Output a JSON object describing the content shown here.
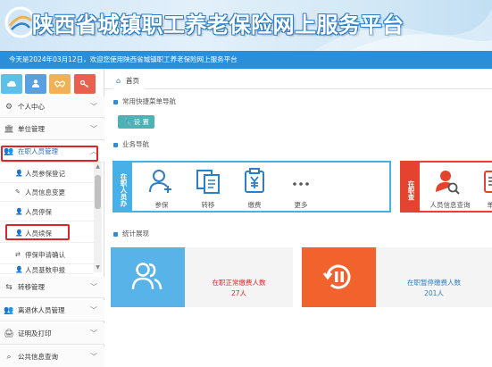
{
  "header": {
    "site_title": "陕西省城镇职工养老保险网上服务平台",
    "welcome": "今天是2024年03月12日，欢迎您使用陕西省城镇职工养老保险网上服务平台",
    "logo_icon": "pension-logo-icon",
    "banner_color": "#cfe6f7",
    "bar_color": "#2b8ed8"
  },
  "toolbar": {
    "buttons": [
      {
        "icon": "cloud-icon",
        "color": "#5cc0ea"
      },
      {
        "icon": "user-icon",
        "color": "#5aa0e0"
      },
      {
        "icon": "handshake-icon",
        "color": "#f2b155"
      },
      {
        "icon": "key-icon",
        "color": "#e8614f"
      }
    ]
  },
  "sidebar": {
    "menu": [
      {
        "label": "个人中心",
        "icon": "gear-icon"
      },
      {
        "label": "单位管理",
        "icon": "bank-icon"
      },
      {
        "label": "在职人员管理",
        "icon": "users-icon"
      }
    ],
    "submenu": [
      {
        "label": "人员参保登记",
        "icon": "user-add-icon"
      },
      {
        "label": "人员信息变更",
        "icon": "edit-icon"
      },
      {
        "label": "人员停保",
        "icon": "user-pause-icon"
      },
      {
        "label": "人员续保",
        "icon": "user-renew-icon"
      },
      {
        "label": "停保申请确认",
        "icon": "confirm-icon"
      },
      {
        "label": "人员基数申报",
        "icon": "user-declare-icon"
      }
    ],
    "menu_bottom": [
      {
        "label": "转移管理",
        "icon": "transfer-icon"
      },
      {
        "label": "离退休人员管理",
        "icon": "retiree-icon"
      },
      {
        "label": "证明及打印",
        "icon": "print-icon"
      },
      {
        "label": "公共信息查询",
        "icon": "search-icon"
      }
    ],
    "highlight_color": "#d9262a"
  },
  "main": {
    "tab_home": "首页",
    "section_quick": "常用快捷菜单导航",
    "set_button": "设 置",
    "section_business": "业务导航",
    "business_label": "在职人员办",
    "business_items": [
      {
        "label": "参保",
        "icon": "user-add-icon"
      },
      {
        "label": "转移",
        "icon": "transfer-icon"
      },
      {
        "label": "缴费",
        "icon": "payment-icon"
      },
      {
        "label": "更多",
        "icon": "more-icon"
      }
    ],
    "query_label": "在职查",
    "query_items": [
      {
        "label": "人员信息查询",
        "icon": "user-search-icon"
      },
      {
        "label": "单位",
        "icon": "document-icon"
      }
    ],
    "section_stats": "统计展现",
    "stats": [
      {
        "label": "在职正常缴费人数",
        "value": "27人",
        "icon": "users-icon",
        "color": "#58b3e8"
      },
      {
        "label": "在职暂停缴费人数",
        "value": "201人",
        "icon": "pause-icon",
        "color": "#f2622c"
      }
    ],
    "accent_blue": "#47b0e6",
    "accent_red": "#e4432f"
  }
}
